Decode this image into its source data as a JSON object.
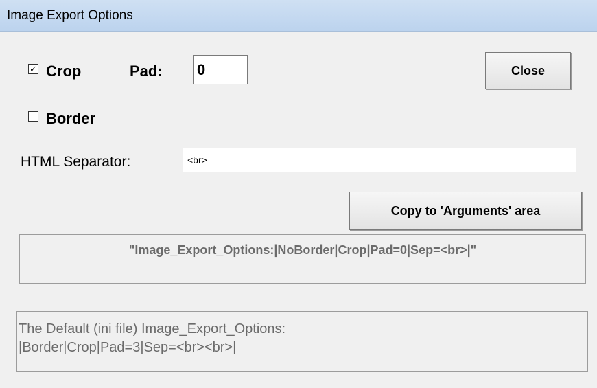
{
  "window": {
    "title": "Image Export Options"
  },
  "crop": {
    "label": "Crop",
    "checked": true,
    "mark": "✓"
  },
  "pad": {
    "label": "Pad:",
    "value": "0"
  },
  "border": {
    "label": "Border",
    "checked": false,
    "mark": ""
  },
  "separator": {
    "label": "HTML Separator:",
    "value": "<br>"
  },
  "buttons": {
    "close": "Close",
    "copy": "Copy to 'Arguments' area"
  },
  "arguments_text": "\"Image_Export_Options:|NoBorder|Crop|Pad=0|Sep=<br>|\"",
  "defaults": {
    "line1": "The Default (ini file) Image_Export_Options:",
    "line2": "|Border|Crop|Pad=3|Sep=<br><br>|"
  }
}
